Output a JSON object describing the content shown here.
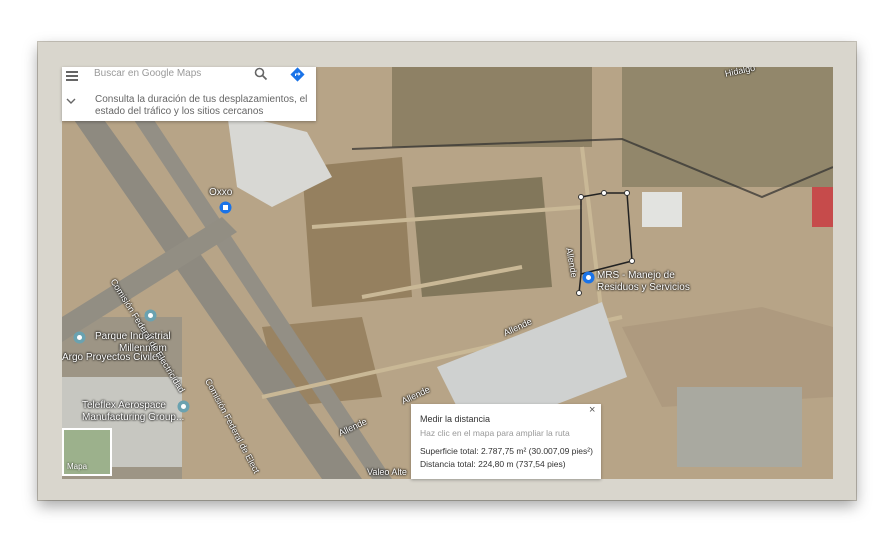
{
  "search": {
    "placeholder": "Buscar en Google Maps",
    "commute_text": "Consulta la duración de tus desplazamientos, el estado del tráfico y los sitios cercanos"
  },
  "places": {
    "oxxo": "Oxxo",
    "mrs_line1": "MRS - Manejo de",
    "mrs_line2": "Residuos y Servicios",
    "parque_line1": "Parque Industrial",
    "parque_line2": "Millennium",
    "argo": "Argo Proyectos Civiles",
    "teleflex_line1": "Teleflex Aerospace",
    "teleflex_line2": "Manufacturing Group..."
  },
  "roads": {
    "cfe_1": "Comisión Federal de Electricidad",
    "cfe_2": "Comisión Federal de Elect",
    "allende_1": "Allende",
    "allende_2": "Allende",
    "allende_3": "Allende",
    "allende_4": "Allende",
    "hidalgo": "Hidalgo",
    "valeo": "Valeo Alte"
  },
  "measure": {
    "title": "Medir la distancia",
    "hint": "Haz clic en el mapa para ampliar la ruta",
    "area": "Superficie total: 2.787,75 m² (30.007,09 pies²)",
    "distance": "Distancia total: 224,80 m (737,54 pies)",
    "close": "×"
  },
  "layer": {
    "label": "Mapa"
  },
  "icons": {
    "search": "search-icon",
    "directions": "directions-icon",
    "menu": "menu-icon",
    "chevron": "chevron-down-icon",
    "close": "close-icon",
    "pin": "map-pin-icon"
  },
  "colors": {
    "pin": "#1a73e8",
    "directions": "#1a73e8",
    "terrain": "#b9a58a"
  }
}
